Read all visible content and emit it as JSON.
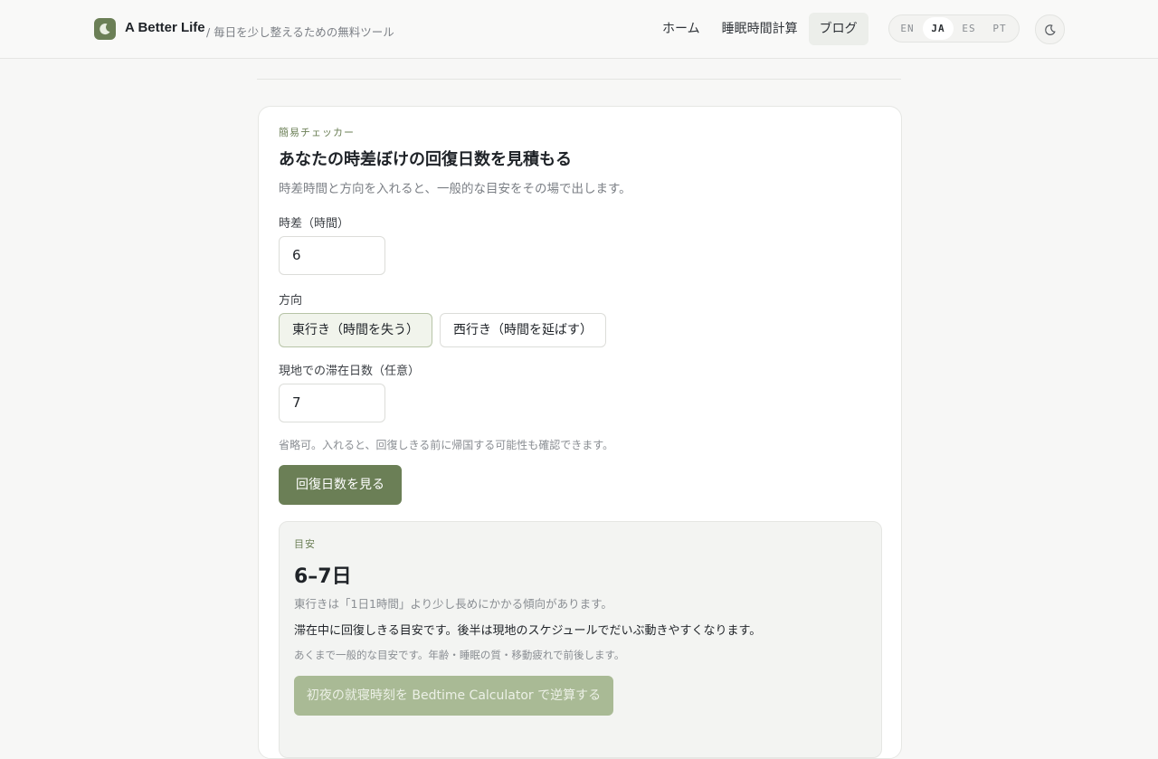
{
  "header": {
    "brand": "A Better Life",
    "tagline": "/ 毎日を少し整えるための無料ツール",
    "nav": [
      "ホーム",
      "睡眠時間計算",
      "ブログ"
    ],
    "active_nav": "ブログ",
    "languages": [
      "EN",
      "JA",
      "ES",
      "PT"
    ],
    "active_language": "JA",
    "theme_icon": "moon-icon",
    "accent_color": "#6b7f56"
  },
  "checker": {
    "eyebrow": "簡易チェッカー",
    "title": "あなたの時差ぼけの回復日数を見積もる",
    "description": "時差時間と方向を入れると、一般的な目安をその場で出します。",
    "offset_label": "時差（時間）",
    "offset_value": "6",
    "direction_label": "方向",
    "direction_options": [
      "東行き（時間を失う）",
      "西行き（時間を延ばす）"
    ],
    "direction_selected": "東行き（時間を失う）",
    "stay_label": "現地での滞在日数（任意）",
    "stay_value": "7",
    "stay_hint": "省略可。入れると、回復しきる前に帰国する可能性も確認できます。",
    "submit_label": "回復日数を見る"
  },
  "result": {
    "eyebrow": "目安",
    "value": "6–7日",
    "note": "東行きは「1日1時間」より少し長めにかかる傾向があります。",
    "summary": "滞在中に回復しきる目安です。後半は現地のスケジュールでだいぶ動きやすくなります。",
    "disclaimer": "あくまで一般的な目安です。年齢・睡眠の質・移動疲れで前後します。",
    "cta_label": "初夜の就寝時刻を Bedtime Calculator で逆算する"
  }
}
